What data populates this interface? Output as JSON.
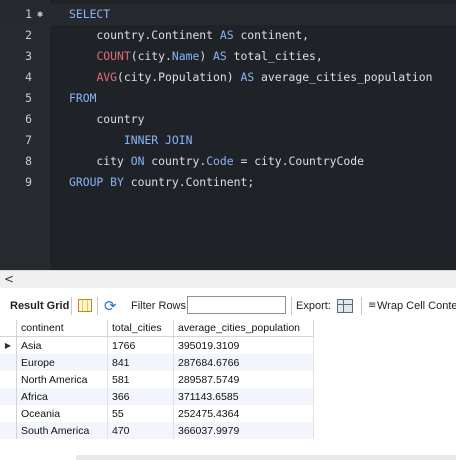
{
  "editor": {
    "lines": [
      {
        "n": "1",
        "fold": "✱",
        "tokens": [
          {
            "t": "SELECT",
            "c": "kw"
          }
        ]
      },
      {
        "n": "2",
        "tokens": [
          {
            "t": "    country.Continent ",
            "c": "pl"
          },
          {
            "t": "AS",
            "c": "kw"
          },
          {
            "t": " continent,",
            "c": "pl"
          }
        ]
      },
      {
        "n": "3",
        "tokens": [
          {
            "t": "    ",
            "c": "pl"
          },
          {
            "t": "COUNT",
            "c": "fn"
          },
          {
            "t": "(city.",
            "c": "pl"
          },
          {
            "t": "Name",
            "c": "kw"
          },
          {
            "t": ") ",
            "c": "pl"
          },
          {
            "t": "AS",
            "c": "kw"
          },
          {
            "t": " total_cities,",
            "c": "pl"
          }
        ]
      },
      {
        "n": "4",
        "tokens": [
          {
            "t": "    ",
            "c": "pl"
          },
          {
            "t": "AVG",
            "c": "fn"
          },
          {
            "t": "(city.Population) ",
            "c": "pl"
          },
          {
            "t": "AS",
            "c": "kw"
          },
          {
            "t": " average_cities_population",
            "c": "pl"
          }
        ]
      },
      {
        "n": "5",
        "tokens": [
          {
            "t": "FROM",
            "c": "kw"
          }
        ]
      },
      {
        "n": "6",
        "tokens": [
          {
            "t": "    country",
            "c": "pl"
          }
        ]
      },
      {
        "n": "7",
        "tokens": [
          {
            "t": "        ",
            "c": "pl"
          },
          {
            "t": "INNER JOIN",
            "c": "kw"
          }
        ]
      },
      {
        "n": "8",
        "tokens": [
          {
            "t": "    city ",
            "c": "pl"
          },
          {
            "t": "ON",
            "c": "kw"
          },
          {
            "t": " country.",
            "c": "pl"
          },
          {
            "t": "Code",
            "c": "kw"
          },
          {
            "t": " = city.CountryCode",
            "c": "pl"
          }
        ]
      },
      {
        "n": "9",
        "tokens": [
          {
            "t": "GROUP BY",
            "c": "kw"
          },
          {
            "t": " country.Continent;",
            "c": "pl"
          }
        ]
      }
    ]
  },
  "scrollbar": {
    "left_arrow": "<"
  },
  "toolbar": {
    "result_grid_label": "Result Grid",
    "filter_label": "Filter Rows:",
    "filter_value": "",
    "export_label": "Export:",
    "wrap_label": "Wrap Cell Content:"
  },
  "grid": {
    "columns": [
      "continent",
      "total_cities",
      "average_cities_population"
    ],
    "rows": [
      [
        "Asia",
        "1766",
        "395019.3109"
      ],
      [
        "Europe",
        "841",
        "287684.6766"
      ],
      [
        "North America",
        "581",
        "289587.5749"
      ],
      [
        "Africa",
        "366",
        "371143.6585"
      ],
      [
        "Oceania",
        "55",
        "252475.4364"
      ],
      [
        "South America",
        "470",
        "366037.9979"
      ]
    ],
    "current_row_marker": "▶"
  },
  "colors": {
    "editor_bg": "#1f2328",
    "keyword": "#8ab4f8",
    "function": "#e06c75",
    "text": "#dcdfe4",
    "alt_row": "#f2f5fb"
  }
}
